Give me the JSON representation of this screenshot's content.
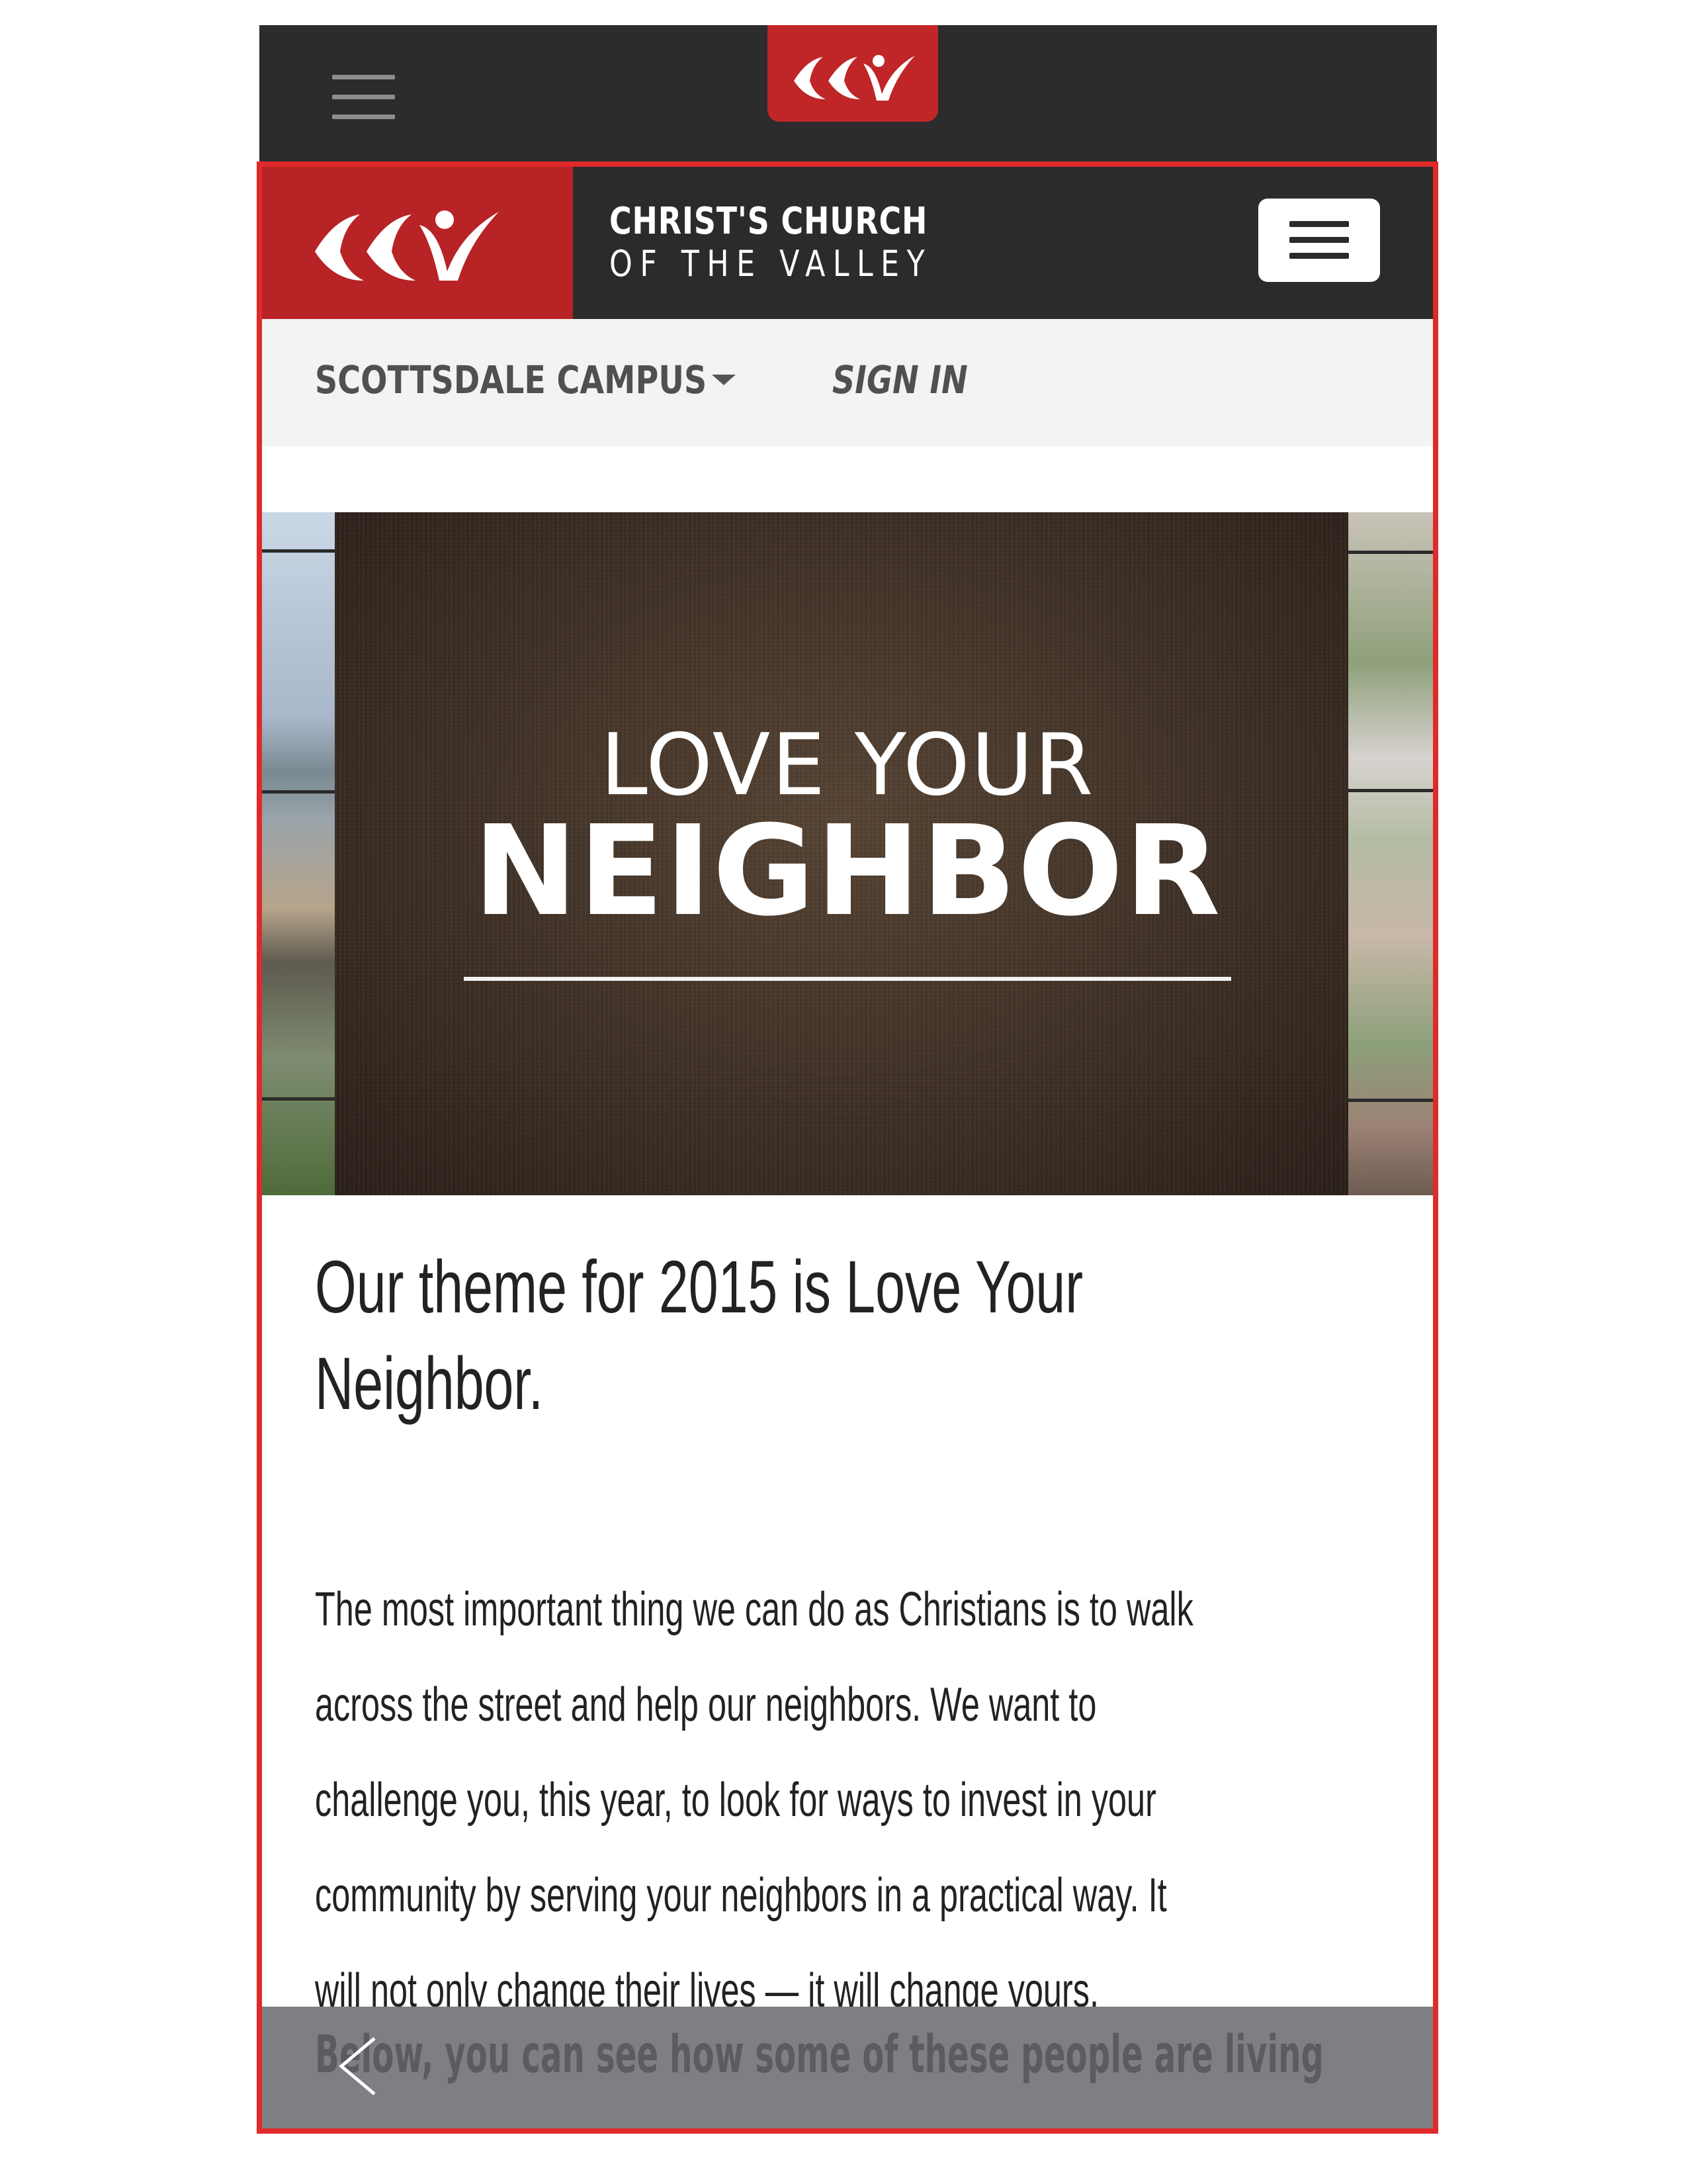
{
  "top_bar": {
    "menu_icon": "hamburger-icon",
    "logo_icon": "ccv-logo"
  },
  "site_header": {
    "logo_icon": "ccv-logo",
    "brand_line1": "CHRIST'S CHURCH",
    "brand_line2": "OF THE VALLEY",
    "menu_icon": "hamburger-icon"
  },
  "subnav": {
    "campus_label": "SCOTTSDALE CAMPUS",
    "campus_caret_icon": "caret-down-icon",
    "sign_in_label": "SIGN IN"
  },
  "hero": {
    "title_line1": "LOVE YOUR",
    "title_line2": "NEIGHBOR"
  },
  "content": {
    "heading_line1": "Our theme for 2015 is Love Your",
    "heading_line2": "Neighbor.",
    "paragraph_lines": [
      "The most important thing we can do as Christians is to walk",
      "across the street and help our neighbors. We want to",
      "challenge you, this year, to look for ways to invest in your",
      "community by serving your neighbors in a practical way. It",
      "will not only change their lives — it will change yours."
    ],
    "partial_line": "Below, you can see how some of these people are living"
  },
  "bottom_bar": {
    "back_icon": "chevron-left-icon"
  },
  "colors": {
    "brand_red": "#b82326",
    "dark_header": "#2b2b2b",
    "frame_red": "#e02a2a"
  }
}
